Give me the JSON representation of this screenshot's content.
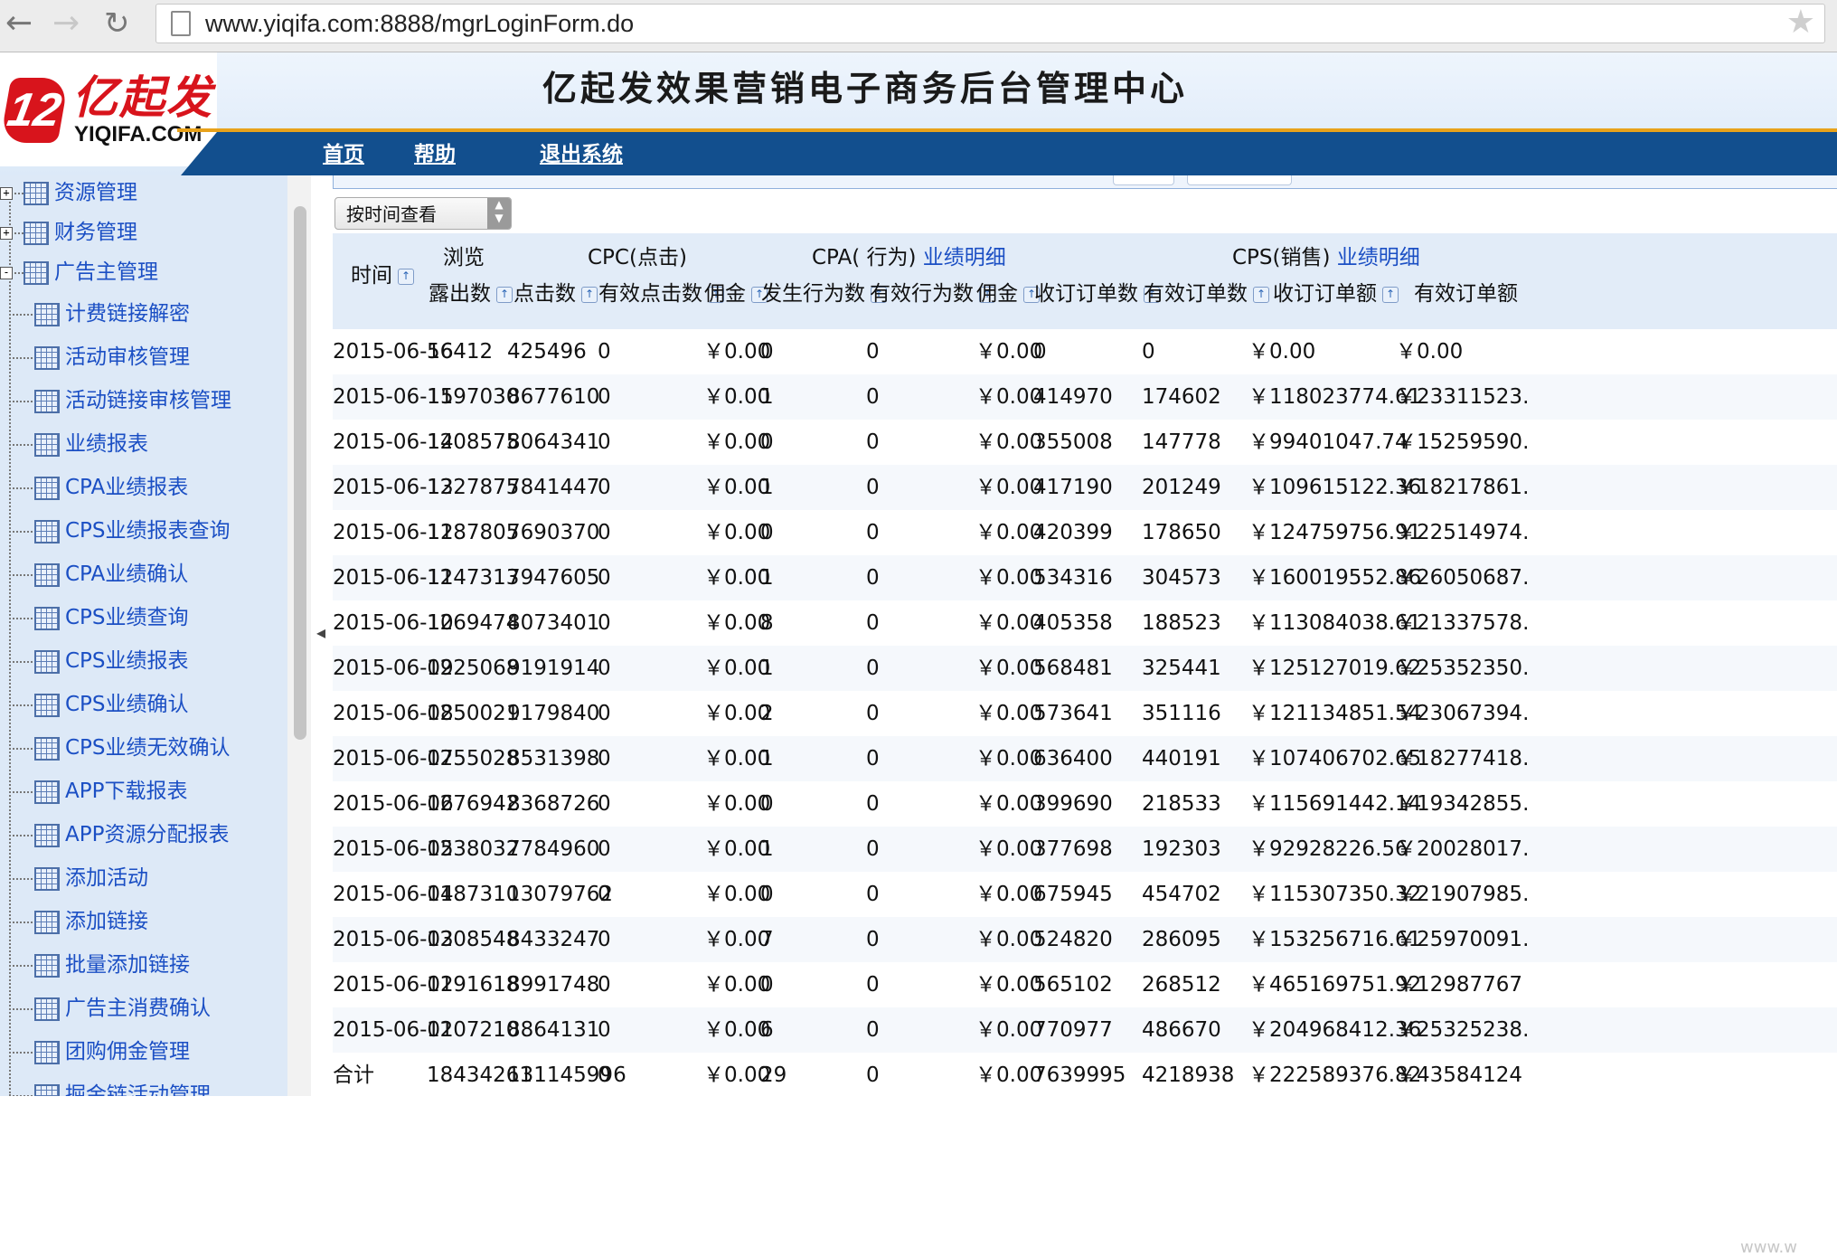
{
  "browser": {
    "url": "www.yiqifa.com:8888/mgrLoginForm.do",
    "back_icon": "arrow-left-icon",
    "forward_icon": "arrow-right-icon",
    "reload_icon": "reload-icon",
    "bookmark_icon": "star-icon"
  },
  "header": {
    "logo_cn": "亿起发",
    "logo_en": "YIQIFA.COM",
    "title": "亿起发效果营销电子商务后台管理中心",
    "nav": {
      "home": "首页",
      "help": "帮助",
      "logout": "退出系统"
    },
    "colors": {
      "nav_bg": "#124f8e",
      "accent": "#e8a21b",
      "brand_red": "#d8141c"
    }
  },
  "sidebar": {
    "groups": [
      {
        "label": "资源管理",
        "toggle": "+"
      },
      {
        "label": "财务管理",
        "toggle": "+"
      },
      {
        "label": "广告主管理",
        "toggle": "-"
      }
    ],
    "items": [
      "计费链接解密",
      "活动审核管理",
      "活动链接审核管理",
      "业绩报表",
      "CPA业绩报表",
      "CPS业绩报表查询",
      "CPA业绩确认",
      "CPS业绩查询",
      "CPS业绩报表",
      "CPS业绩确认",
      "CPS业绩无效确认",
      "APP下载报表",
      "APP资源分配报表",
      "添加活动",
      "添加链接",
      "批量添加链接",
      "广告主消费确认",
      "团购佣金管理",
      "掘金链活动管理"
    ]
  },
  "main": {
    "view_select": "按时间查看",
    "group_headers": {
      "browse": "浏览",
      "cpc": "CPC(点击)",
      "cpa": "CPA( 行为)",
      "cpa_link": "业绩明细",
      "cps": "CPS(销售)",
      "cps_link": "业绩明细"
    },
    "columns": [
      "时间",
      "露出数",
      "点击数",
      "有效点击数",
      "佣金",
      "发生行为数",
      "有效行为数",
      "佣金",
      "收订订单数",
      "有效订单数",
      "收订订单额",
      "有效订单额"
    ],
    "rows": [
      [
        "2015-06-16",
        "56412",
        "425496",
        "0",
        "￥0.00",
        "0",
        "0",
        "￥0.00",
        "0",
        "0",
        "￥0.00",
        "￥0.00"
      ],
      [
        "2015-06-15",
        "1197030",
        "8677610",
        "0",
        "￥0.00",
        "1",
        "0",
        "￥0.00",
        "414970",
        "174602",
        "￥118023774.61",
        "￥23311523."
      ],
      [
        "2015-06-14",
        "1208575",
        "8064341",
        "0",
        "￥0.00",
        "0",
        "0",
        "￥0.00",
        "355008",
        "147778",
        "￥99401047.74",
        "￥15259590."
      ],
      [
        "2015-06-13",
        "1227875",
        "7841447",
        "0",
        "￥0.00",
        "1",
        "0",
        "￥0.00",
        "417190",
        "201249",
        "￥109615122.36",
        "￥18217861."
      ],
      [
        "2015-06-12",
        "1187805",
        "7690370",
        "0",
        "￥0.00",
        "0",
        "0",
        "￥0.00",
        "420399",
        "178650",
        "￥124759756.91",
        "￥22514974."
      ],
      [
        "2015-06-11",
        "1247313",
        "7947605",
        "0",
        "￥0.00",
        "1",
        "0",
        "￥0.00",
        "534316",
        "304573",
        "￥160019552.86",
        "￥26050687."
      ],
      [
        "2015-06-10",
        "1269474",
        "8073401",
        "0",
        "￥0.00",
        "8",
        "0",
        "￥0.00",
        "405358",
        "188523",
        "￥113084038.61",
        "￥21337578."
      ],
      [
        "2015-06-09",
        "1225068",
        "9191914",
        "0",
        "￥0.00",
        "1",
        "0",
        "￥0.00",
        "568481",
        "325441",
        "￥125127019.62",
        "￥25352350."
      ],
      [
        "2015-06-08",
        "1250021",
        "9179840",
        "0",
        "￥0.00",
        "2",
        "0",
        "￥0.00",
        "573641",
        "351116",
        "￥121134851.54",
        "￥23067394."
      ],
      [
        "2015-06-07",
        "1255028",
        "8531398",
        "0",
        "￥0.00",
        "1",
        "0",
        "￥0.00",
        "636400",
        "440191",
        "￥107406702.65",
        "￥18277418."
      ],
      [
        "2015-06-06",
        "1276942",
        "8368726",
        "0",
        "￥0.00",
        "0",
        "0",
        "￥0.00",
        "399690",
        "218533",
        "￥115691442.14",
        "￥19342855."
      ],
      [
        "2015-06-05",
        "1238032",
        "7784960",
        "0",
        "￥0.00",
        "1",
        "0",
        "￥0.00",
        "377698",
        "192303",
        "￥92928226.56",
        "￥20028017."
      ],
      [
        "2015-06-04",
        "1187310",
        "13079762",
        "0",
        "￥0.00",
        "0",
        "0",
        "￥0.00",
        "675945",
        "454702",
        "￥115307350.32",
        "￥21907985."
      ],
      [
        "2015-06-03",
        "1208548",
        "8433247",
        "0",
        "￥0.00",
        "7",
        "0",
        "￥0.00",
        "524820",
        "286095",
        "￥153256716.61",
        "￥25970091."
      ],
      [
        "2015-06-02",
        "1191618",
        "8991748",
        "0",
        "￥0.00",
        "0",
        "0",
        "￥0.00",
        "565102",
        "268512",
        "￥465169751.92",
        "￥12987767"
      ],
      [
        "2015-06-01",
        "1207210",
        "8864131",
        "0",
        "￥0.00",
        "6",
        "0",
        "￥0.00",
        "770977",
        "486670",
        "￥204968412.36",
        "￥25325238."
      ],
      [
        "合计",
        "18434261",
        "131145996",
        "0",
        "￥0.00",
        "29",
        "0",
        "￥0.00",
        "7639995",
        "4218938",
        "￥222589376.82",
        "￥43584124"
      ]
    ],
    "watermark": "www.w"
  }
}
